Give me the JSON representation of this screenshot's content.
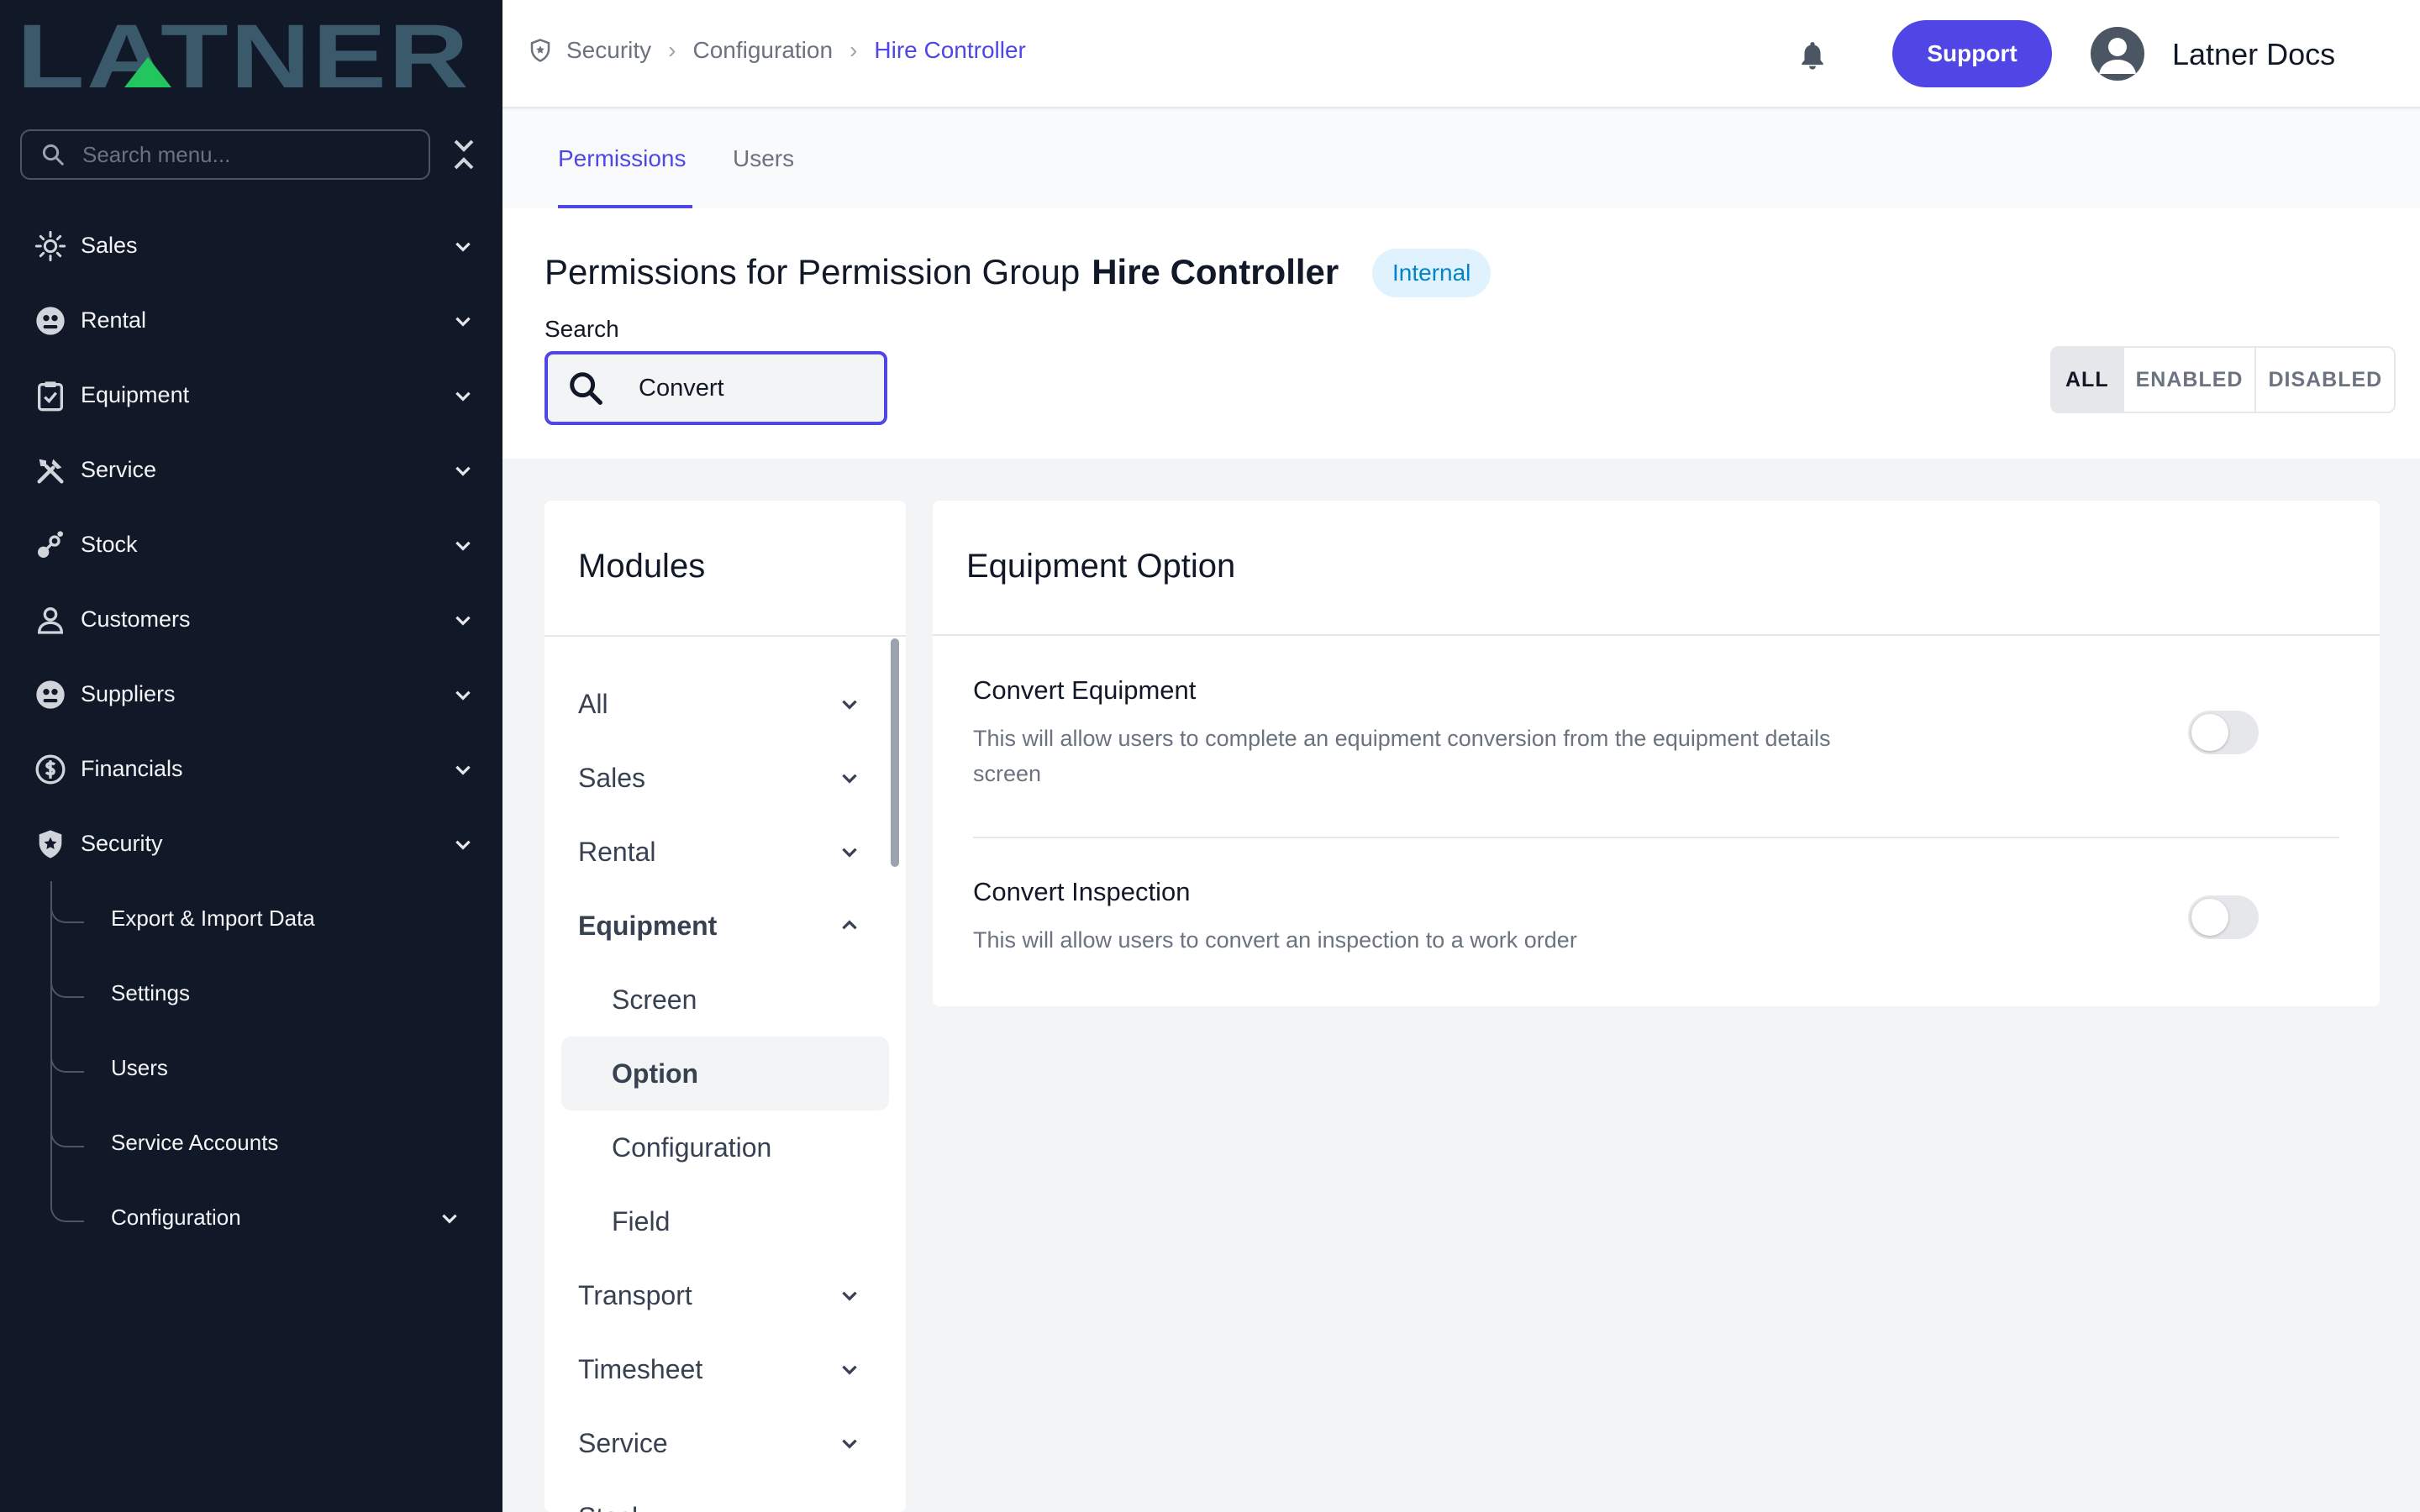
{
  "app": {
    "logo_text": "LATNER"
  },
  "sidebar": {
    "search_placeholder": "Search menu...",
    "items": [
      {
        "label": "Sales",
        "icon": "sales-icon"
      },
      {
        "label": "Rental",
        "icon": "rental-icon"
      },
      {
        "label": "Equipment",
        "icon": "equipment-icon"
      },
      {
        "label": "Service",
        "icon": "service-icon"
      },
      {
        "label": "Stock",
        "icon": "stock-icon"
      },
      {
        "label": "Customers",
        "icon": "customers-icon"
      },
      {
        "label": "Suppliers",
        "icon": "suppliers-icon"
      },
      {
        "label": "Financials",
        "icon": "financials-icon"
      },
      {
        "label": "Security",
        "icon": "security-icon"
      }
    ],
    "security_sub": [
      {
        "label": "Export & Import Data"
      },
      {
        "label": "Settings"
      },
      {
        "label": "Users"
      },
      {
        "label": "Service Accounts"
      },
      {
        "label": "Configuration"
      }
    ]
  },
  "header": {
    "breadcrumb": [
      "Security",
      "Configuration",
      "Hire Controller"
    ],
    "support_label": "Support",
    "user_name": "Latner Docs"
  },
  "tabs": [
    {
      "label": "Permissions",
      "active": true
    },
    {
      "label": "Users",
      "active": false
    }
  ],
  "page": {
    "title_prefix": "Permissions for Permission Group",
    "group_name": "Hire Controller",
    "badge": "Internal",
    "search_label": "Search",
    "search_value": "Convert",
    "filters": [
      "ALL",
      "ENABLED",
      "DISABLED"
    ],
    "selected_filter": "ALL"
  },
  "modules": {
    "title": "Modules",
    "items": [
      {
        "label": "All"
      },
      {
        "label": "Sales"
      },
      {
        "label": "Rental"
      },
      {
        "label": "Equipment",
        "expanded": true
      },
      {
        "label": "Screen"
      },
      {
        "label": "Option",
        "selected": true
      },
      {
        "label": "Configuration"
      },
      {
        "label": "Field"
      },
      {
        "label": "Transport"
      },
      {
        "label": "Timesheet"
      },
      {
        "label": "Service"
      },
      {
        "label": "Stock"
      }
    ]
  },
  "details": {
    "title": "Equipment Option",
    "permissions": [
      {
        "title": "Convert Equipment",
        "description": "This will allow users to complete an equipment conversion from the equipment details screen",
        "enabled": false
      },
      {
        "title": "Convert Inspection",
        "description": "This will allow users to convert an inspection to a work order",
        "enabled": false
      }
    ]
  },
  "colors": {
    "accent": "#4f46e5",
    "sidebar_bg": "#111827",
    "logo": "#3a5a6b",
    "logo_accent": "#22c55e",
    "badge_bg": "#e0f2fe",
    "badge_text": "#0284c7"
  }
}
